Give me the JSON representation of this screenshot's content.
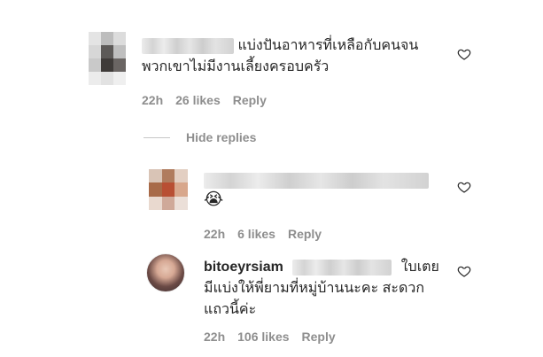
{
  "comments": [
    {
      "text_line1": "แบ่งปันอาหารที่เหลือกับคนจน",
      "text_line2": "พวกเขาไม่มีงานเลี้ยงครอบครัว",
      "time": "22h",
      "likes": "26 likes",
      "reply": "Reply"
    }
  ],
  "hide_replies": "Hide replies",
  "replies": [
    {
      "emoji": "😭",
      "time": "22h",
      "likes": "6 likes",
      "reply": "Reply"
    },
    {
      "username": "bitoeyrsiam",
      "text_line1": "ใบเตย",
      "text_line2": "มีแบ่งให้พี่ยามที่หมู่บ้านนะคะ สะดวก",
      "text_line3": "แถวนี้ค่ะ",
      "time": "22h",
      "likes": "106 likes",
      "reply": "Reply"
    }
  ],
  "colors": {
    "text": "#262626",
    "muted": "#8e8e8e"
  }
}
